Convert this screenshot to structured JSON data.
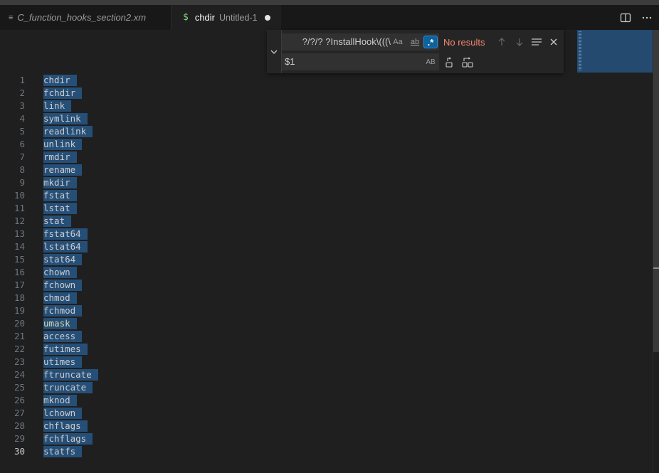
{
  "tabs": [
    {
      "icon": "≡",
      "title": "C_function_hooks_section2.xm",
      "description": "",
      "active": false
    },
    {
      "icon": "$",
      "title": "chdir",
      "description": "Untitled-1",
      "active": true,
      "dirty": true
    }
  ],
  "tab_actions": {
    "split_icon": "split-editor-icon",
    "more_icon": "more-actions-icon"
  },
  "find": {
    "search_value": "?/?/? ?InstallHook\\(((\\",
    "replace_value": "$1",
    "status": "No results",
    "options": {
      "case": "Aa",
      "word": "ab",
      "regex": ".*",
      "preserve_case": "AB"
    },
    "regex_enabled": true
  },
  "editor": {
    "lines": [
      "chdir",
      "fchdir",
      "link",
      "symlink",
      "readlink",
      "unlink",
      "rmdir",
      "rename",
      "mkdir",
      "fstat",
      "lstat",
      "stat",
      "fstat64",
      "lstat64",
      "stat64",
      "chown",
      "fchown",
      "chmod",
      "fchmod",
      "umask",
      "access",
      "futimes",
      "utimes",
      "ftruncate",
      "truncate",
      "mknod",
      "lchown",
      "chflags",
      "fchflags",
      "statfs"
    ],
    "highlighted_line": 20,
    "active_line": 30
  },
  "colors": {
    "selection": "#264f78",
    "background": "#1f1f1f",
    "status_error": "#f48771",
    "dirty_dot": "#e6e6e6"
  }
}
